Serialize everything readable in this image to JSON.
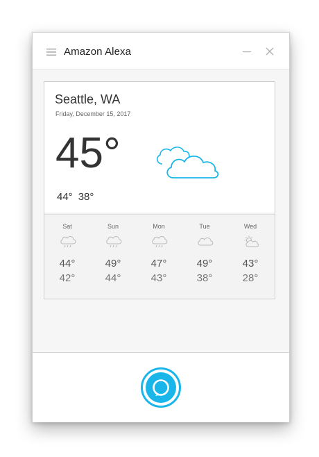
{
  "window": {
    "title": "Amazon Alexa"
  },
  "weather": {
    "location": "Seattle, WA",
    "date": "Friday, December 15, 2017",
    "current_temp": "45°",
    "current_condition_icon": "cloudy-icon",
    "high": "44°",
    "low": "38°",
    "forecast": [
      {
        "day": "Sat",
        "high": "44°",
        "low": "42°",
        "icon": "rain-cloud-icon"
      },
      {
        "day": "Sun",
        "high": "49°",
        "low": "44°",
        "icon": "rain-cloud-icon"
      },
      {
        "day": "Mon",
        "high": "47°",
        "low": "43°",
        "icon": "rain-cloud-icon"
      },
      {
        "day": "Tue",
        "high": "49°",
        "low": "38°",
        "icon": "cloud-icon"
      },
      {
        "day": "Wed",
        "high": "43°",
        "low": "28°",
        "icon": "partly-cloudy-icon"
      }
    ]
  },
  "colors": {
    "accent": "#1ab6ea",
    "text": "#333333",
    "muted": "#777777"
  }
}
